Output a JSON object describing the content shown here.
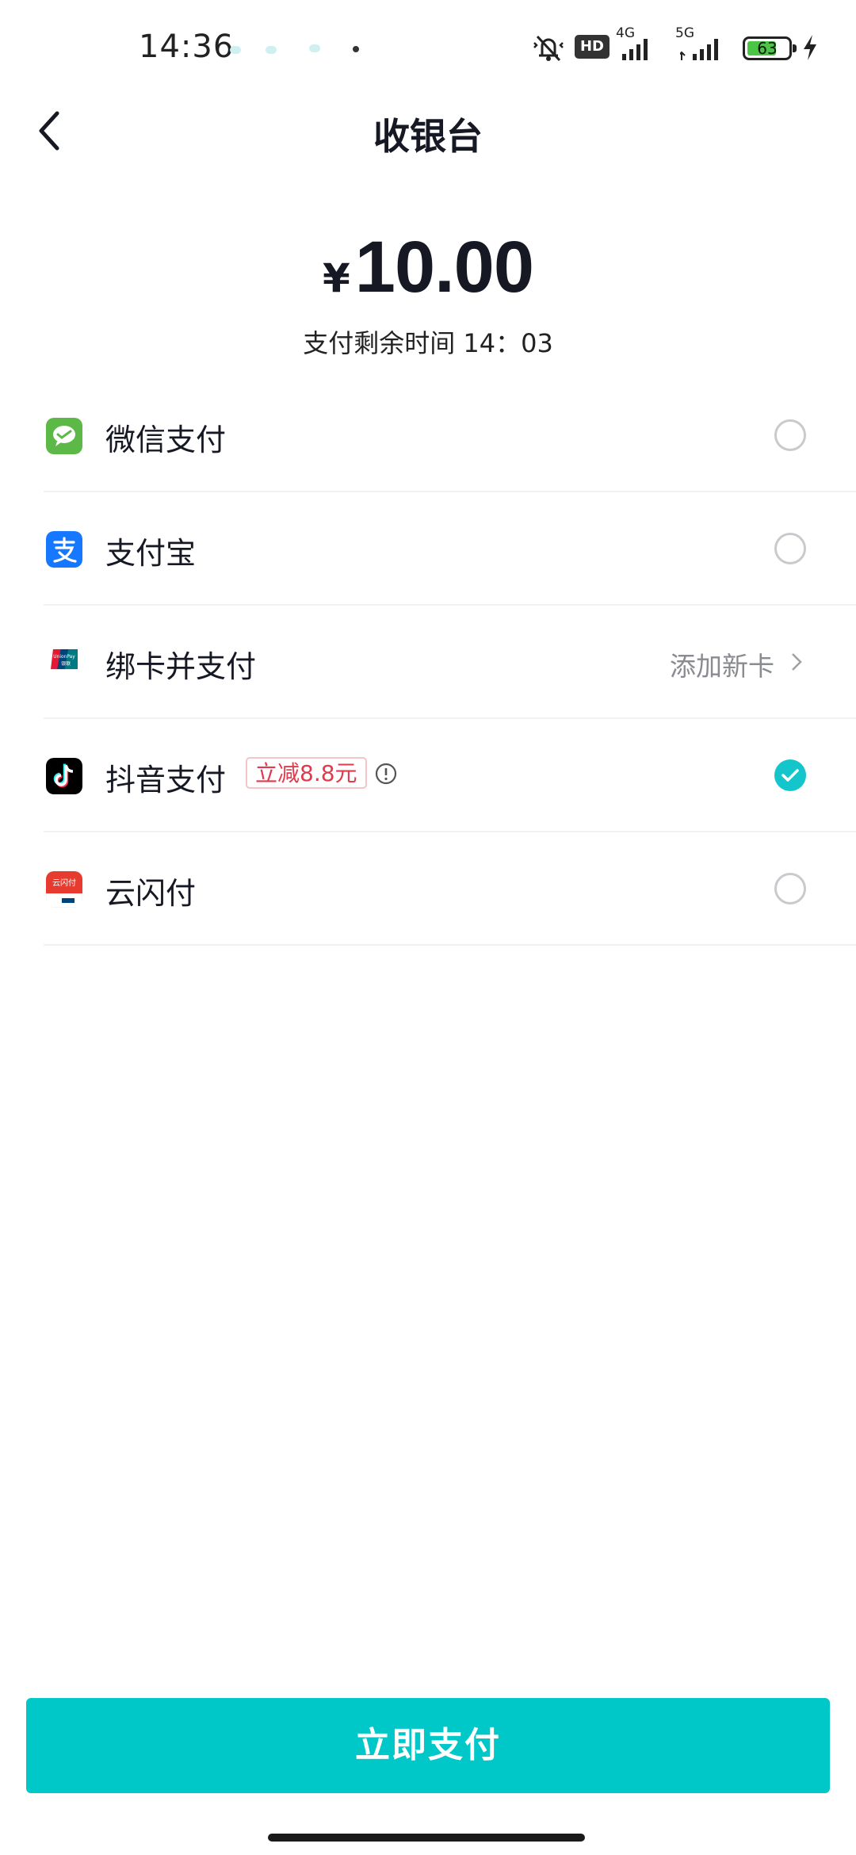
{
  "status_bar": {
    "time": "14:36",
    "network_1": "4G",
    "network_2": "5G",
    "hd_label": "HD",
    "battery": "63",
    "icons": [
      "mute-icon",
      "hd-icon",
      "signal-icon",
      "battery-icon",
      "charging-icon"
    ]
  },
  "header": {
    "title": "收银台",
    "back_icon": "back-arrow-icon"
  },
  "payment": {
    "currency": "¥",
    "amount": "10.00",
    "timer_label": "支付剩余时间 14：03"
  },
  "methods": [
    {
      "label": "微信支付",
      "icon": "wechat-pay-icon",
      "color": "#5cb947",
      "selected": false
    },
    {
      "label": "支付宝",
      "icon": "alipay-icon",
      "color": "#1677ff",
      "selected": false
    },
    {
      "label": "绑卡并支付",
      "icon": "unionpay-icon",
      "action": "添加新卡"
    },
    {
      "label": "抖音支付",
      "icon": "douyin-pay-icon",
      "color": "#000000",
      "promo": "立减8.8元",
      "selected": true
    },
    {
      "label": "云闪付",
      "icon": "quickpass-icon",
      "icon_text": "云闪付",
      "color": "#e63b2e",
      "selected": false
    }
  ],
  "accent_color": "#00c8c8",
  "footer": {
    "pay_button": "立即支付"
  }
}
